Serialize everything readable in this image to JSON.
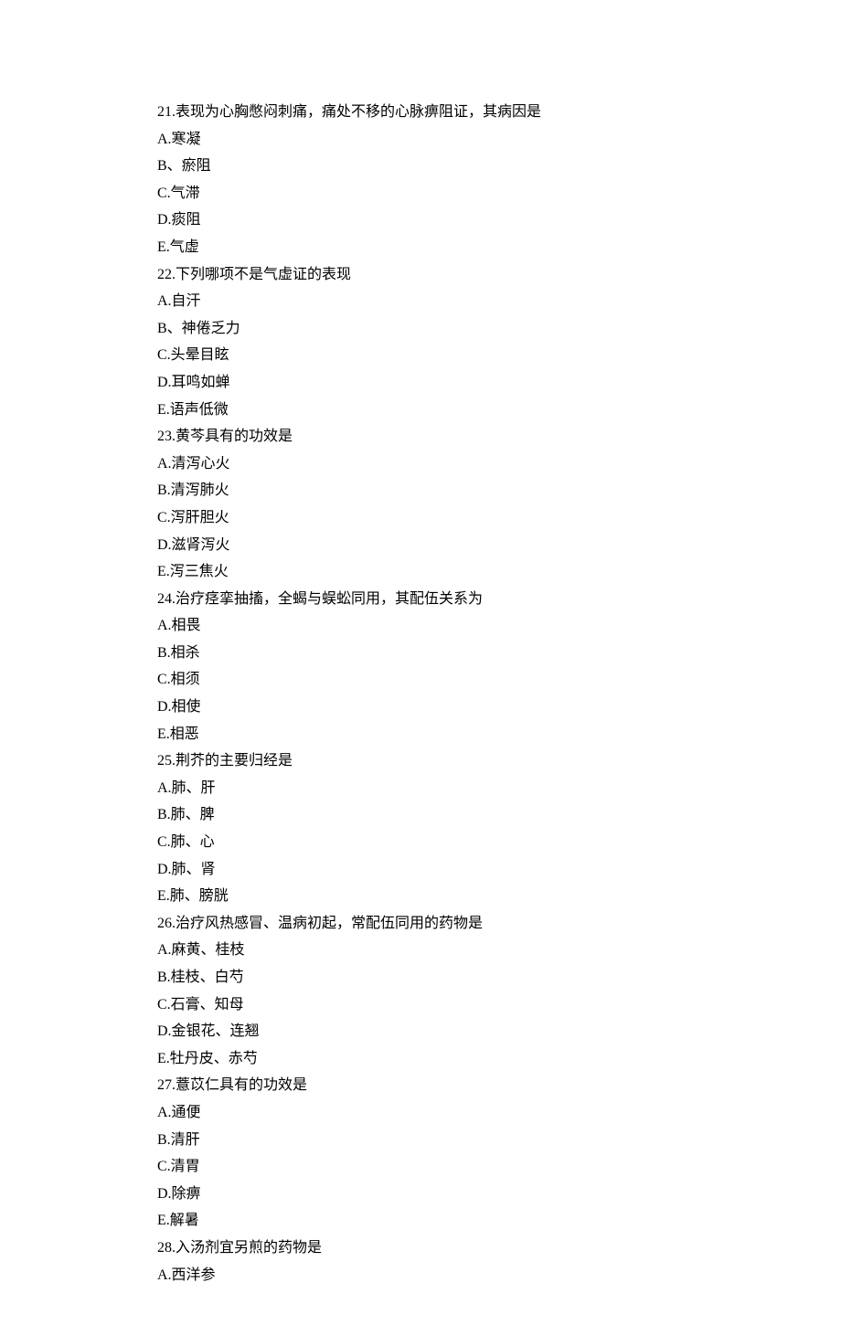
{
  "questions": [
    {
      "number": "21",
      "stem": "21.表现为心胸憋闷刺痛，痛处不移的心脉痹阻证，其病因是",
      "options": [
        "A.寒凝",
        "B、瘀阻",
        "C.气滞",
        "D.痰阻",
        "E.气虚"
      ]
    },
    {
      "number": "22",
      "stem": "22.下列哪项不是气虚证的表现",
      "options": [
        "A.自汗",
        "B、神倦乏力",
        "C.头晕目眩",
        "D.耳鸣如蝉",
        "E.语声低微"
      ]
    },
    {
      "number": "23",
      "stem": "23.黄芩具有的功效是",
      "options": [
        "A.清泻心火",
        "B.清泻肺火",
        "C.泻肝胆火",
        "D.滋肾泻火",
        "E.泻三焦火"
      ]
    },
    {
      "number": "24",
      "stem": "24.治疗痉挛抽搐，全蝎与蜈蚣同用，其配伍关系为",
      "options": [
        "A.相畏",
        "B.相杀",
        "C.相须",
        "D.相使",
        "E.相恶"
      ]
    },
    {
      "number": "25",
      "stem": "25.荆芥的主要归经是",
      "options": [
        "A.肺、肝",
        "B.肺、脾",
        "C.肺、心",
        "D.肺、肾",
        "E.肺、膀胱"
      ]
    },
    {
      "number": "26",
      "stem": "26.治疗风热感冒、温病初起，常配伍同用的药物是",
      "options": [
        "A.麻黄、桂枝",
        "B.桂枝、白芍",
        "C.石膏、知母",
        "D.金银花、连翘",
        "E.牡丹皮、赤芍"
      ]
    },
    {
      "number": "27",
      "stem": "27.薏苡仁具有的功效是",
      "options": [
        "A.通便",
        "B.清肝",
        "C.清胃",
        "D.除痹",
        "E.解暑"
      ]
    },
    {
      "number": "28",
      "stem": "28.入汤剂宜另煎的药物是",
      "options": [
        "A.西洋参"
      ]
    }
  ]
}
